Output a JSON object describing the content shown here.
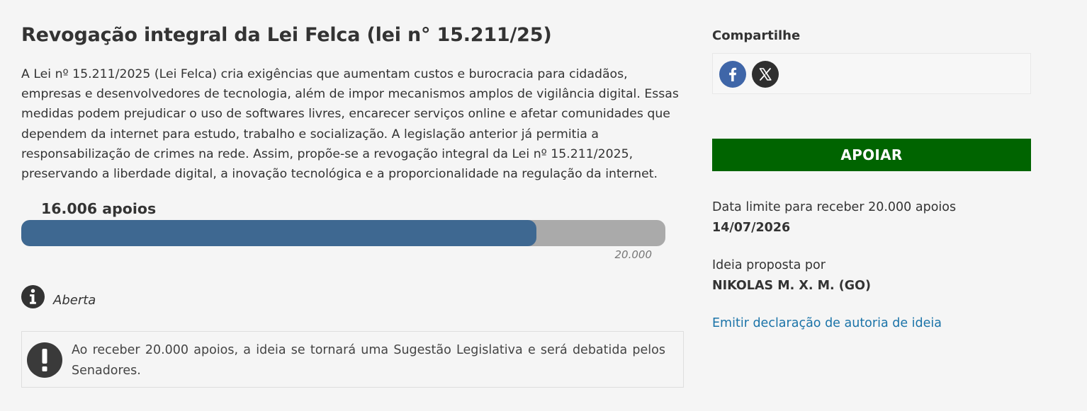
{
  "idea": {
    "title": "Revogação integral da Lei Felca (lei n° 15.211/25)",
    "description": "A Lei nº 15.211/2025 (Lei Felca) cria exigências que aumentam custos e burocracia para cidadãos, empresas e desenvolvedores de tecnologia, além de impor mecanismos amplos de vigilância digital. Essas medidas podem prejudicar o uso de softwares livres, encarecer serviços online e afetar comunidades que dependem da internet para estudo, trabalho e socialização. A legislação anterior já permitia a responsabilização de crimes na rede. Assim, propõe-se a revogação integral da Lei nº 15.211/2025, preservando a liberdade digital, a inovação tecnológica e a proporcionalidade na regulação da internet."
  },
  "progress": {
    "count_label": "16.006 apoios",
    "goal_label": "20.000",
    "fraction": 0.8003,
    "fill_color": "#3e6891",
    "track_color": "#aaaaaa"
  },
  "status": {
    "icon": "info-icon",
    "label": "Aberta"
  },
  "notice": {
    "icon": "exclamation-icon",
    "text": "Ao receber 20.000 apoios, a ideia se tornará uma Sugestão Legislativa e será debatida pelos Senadores."
  },
  "share": {
    "title": "Compartilhe",
    "buttons": [
      {
        "icon": "facebook-icon",
        "color": "#3f66a8"
      },
      {
        "icon": "x-icon",
        "color": "#2f2f2f"
      }
    ]
  },
  "support_button": {
    "label": "APOIAR",
    "color": "#006400"
  },
  "deadline": {
    "label": "Data limite para receber 20.000 apoios",
    "value": "14/07/2026"
  },
  "author": {
    "label": "Ideia proposta por",
    "value": "NIKOLAS M. X. M. (GO)"
  },
  "declaration_link": {
    "label": "Emitir declaração de autoria de ideia",
    "color": "#1a73a8"
  }
}
